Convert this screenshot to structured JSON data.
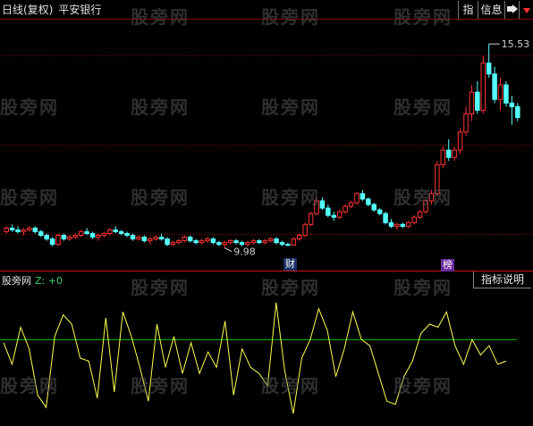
{
  "header": {
    "period": "日线(复权)",
    "stock_name": "平安银行"
  },
  "toolbar": {
    "index_label": "指",
    "info_label": "信息",
    "right_arrow_icon": "arrow-right-icon",
    "dropdown_icon": "dropdown-icon"
  },
  "watermark": "股旁网",
  "price_labels": {
    "high": "15.53",
    "low": "9.98"
  },
  "badges": {
    "cai": "财",
    "bang": "榜"
  },
  "indicator": {
    "title": "股旁网",
    "z_label": "Z: +0",
    "button_label": "指标说明"
  },
  "colors": {
    "up": "#ff3232",
    "down": "#54ffff",
    "grid": "#8b0000",
    "line_yellow": "#ffff50",
    "line_green": "#00c800"
  },
  "chart_data": {
    "type": "candlestick",
    "price_range": [
      9.4,
      16.2
    ],
    "candles": [
      [
        10.35,
        10.5,
        10.3,
        10.45
      ],
      [
        10.45,
        10.55,
        10.35,
        10.4
      ],
      [
        10.4,
        10.5,
        10.3,
        10.35
      ],
      [
        10.35,
        10.45,
        10.25,
        10.4
      ],
      [
        10.4,
        10.5,
        10.35,
        10.45
      ],
      [
        10.45,
        10.5,
        10.3,
        10.35
      ],
      [
        10.35,
        10.4,
        10.2,
        10.25
      ],
      [
        10.25,
        10.3,
        10.1,
        10.15
      ],
      [
        10.15,
        10.2,
        9.95,
        10.0
      ],
      [
        10.0,
        10.3,
        9.95,
        10.25
      ],
      [
        10.25,
        10.3,
        10.1,
        10.15
      ],
      [
        10.15,
        10.25,
        10.1,
        10.2
      ],
      [
        10.2,
        10.3,
        10.15,
        10.25
      ],
      [
        10.25,
        10.4,
        10.2,
        10.35
      ],
      [
        10.35,
        10.45,
        10.25,
        10.3
      ],
      [
        10.3,
        10.35,
        10.15,
        10.2
      ],
      [
        10.2,
        10.3,
        10.1,
        10.25
      ],
      [
        10.25,
        10.35,
        10.2,
        10.3
      ],
      [
        10.3,
        10.45,
        10.25,
        10.4
      ],
      [
        10.4,
        10.5,
        10.3,
        10.35
      ],
      [
        10.35,
        10.4,
        10.25,
        10.3
      ],
      [
        10.3,
        10.35,
        10.2,
        10.25
      ],
      [
        10.25,
        10.3,
        10.1,
        10.15
      ],
      [
        10.15,
        10.25,
        10.1,
        10.2
      ],
      [
        10.2,
        10.25,
        10.05,
        10.1
      ],
      [
        10.1,
        10.2,
        10.0,
        10.15
      ],
      [
        10.15,
        10.25,
        10.1,
        10.2
      ],
      [
        10.2,
        10.3,
        10.1,
        10.15
      ],
      [
        10.15,
        10.2,
        9.95,
        10.0
      ],
      [
        10.0,
        10.1,
        9.95,
        10.05
      ],
      [
        10.05,
        10.15,
        10.0,
        10.1
      ],
      [
        10.1,
        10.25,
        10.05,
        10.2
      ],
      [
        10.2,
        10.25,
        10.05,
        10.1
      ],
      [
        10.1,
        10.15,
        10.0,
        10.05
      ],
      [
        10.05,
        10.15,
        10.0,
        10.1
      ],
      [
        10.1,
        10.2,
        10.05,
        10.15
      ],
      [
        10.15,
        10.2,
        10.0,
        10.05
      ],
      [
        10.05,
        10.1,
        9.95,
        10.0
      ],
      [
        10.0,
        10.1,
        9.9,
        10.05
      ],
      [
        10.05,
        10.15,
        10.0,
        10.1
      ],
      [
        10.1,
        10.15,
        10.0,
        10.05
      ],
      [
        10.05,
        10.1,
        9.95,
        10.0
      ],
      [
        10.0,
        10.1,
        9.95,
        10.05
      ],
      [
        10.05,
        10.15,
        10.0,
        10.1
      ],
      [
        10.1,
        10.15,
        10.0,
        10.05
      ],
      [
        10.05,
        10.15,
        10.0,
        10.1
      ],
      [
        10.1,
        10.2,
        10.05,
        10.15
      ],
      [
        10.15,
        10.2,
        10.0,
        10.05
      ],
      [
        10.05,
        10.1,
        9.95,
        10.0
      ],
      [
        10.0,
        10.05,
        9.95,
        9.98
      ],
      [
        9.98,
        10.2,
        9.98,
        10.15
      ],
      [
        10.15,
        10.3,
        10.1,
        10.25
      ],
      [
        10.25,
        10.6,
        10.2,
        10.55
      ],
      [
        10.55,
        10.9,
        10.5,
        10.85
      ],
      [
        10.85,
        11.3,
        10.8,
        11.2
      ],
      [
        11.2,
        11.3,
        10.95,
        11.0
      ],
      [
        11.0,
        11.1,
        10.75,
        10.8
      ],
      [
        10.8,
        10.9,
        10.65,
        10.75
      ],
      [
        10.75,
        10.95,
        10.7,
        10.9
      ],
      [
        10.9,
        11.1,
        10.85,
        11.05
      ],
      [
        11.05,
        11.2,
        11.0,
        11.15
      ],
      [
        11.15,
        11.45,
        11.1,
        11.4
      ],
      [
        11.4,
        11.5,
        11.2,
        11.25
      ],
      [
        11.25,
        11.3,
        11.05,
        11.1
      ],
      [
        11.1,
        11.15,
        10.9,
        10.95
      ],
      [
        10.95,
        11.0,
        10.8,
        10.85
      ],
      [
        10.85,
        10.9,
        10.55,
        10.6
      ],
      [
        10.6,
        10.7,
        10.45,
        10.5
      ],
      [
        10.5,
        10.6,
        10.4,
        10.55
      ],
      [
        10.55,
        10.6,
        10.45,
        10.5
      ],
      [
        10.5,
        10.65,
        10.45,
        10.6
      ],
      [
        10.6,
        10.8,
        10.55,
        10.75
      ],
      [
        10.75,
        10.95,
        10.7,
        10.9
      ],
      [
        10.9,
        11.25,
        10.85,
        11.2
      ],
      [
        11.2,
        11.5,
        11.1,
        11.4
      ],
      [
        11.4,
        12.3,
        11.35,
        12.2
      ],
      [
        12.2,
        12.7,
        12.1,
        12.6
      ],
      [
        12.6,
        12.9,
        12.3,
        12.4
      ],
      [
        12.4,
        12.7,
        12.3,
        12.6
      ],
      [
        12.6,
        13.2,
        12.5,
        13.1
      ],
      [
        13.1,
        13.8,
        13.0,
        13.6
      ],
      [
        13.6,
        14.4,
        13.4,
        14.2
      ],
      [
        14.2,
        14.5,
        13.6,
        13.7
      ],
      [
        13.7,
        15.2,
        13.6,
        15.0
      ],
      [
        15.0,
        15.53,
        14.6,
        14.7
      ],
      [
        14.7,
        14.9,
        13.9,
        14.0
      ],
      [
        14.0,
        14.6,
        13.7,
        14.4
      ],
      [
        14.4,
        14.5,
        13.8,
        13.9
      ],
      [
        13.9,
        14.1,
        13.3,
        13.8
      ],
      [
        13.8,
        13.9,
        13.4,
        13.5
      ]
    ],
    "indicator_series": [
      0.45,
      0.1,
      0.7,
      0.35,
      -0.4,
      -0.6,
      0.55,
      0.9,
      0.75,
      0.2,
      0.15,
      -0.45,
      0.85,
      -0.35,
      0.95,
      0.55,
      0.05,
      -0.5,
      0.75,
      0.05,
      0.55,
      -0.05,
      0.45,
      -0.05,
      0.3,
      0.05,
      0.8,
      -0.4,
      0.35,
      0.05,
      -0.05,
      -0.25,
      1.1,
      0.0,
      -0.7,
      0.2,
      0.5,
      1.0,
      0.65,
      -0.1,
      0.35,
      0.95,
      0.5,
      0.4,
      -0.05,
      -0.5,
      -0.55,
      -0.1,
      0.15,
      0.6,
      0.75,
      0.7,
      0.95,
      0.4,
      0.1,
      0.5,
      0.25,
      0.4,
      0.1,
      0.15
    ],
    "indicator_baseline": 0.5
  }
}
